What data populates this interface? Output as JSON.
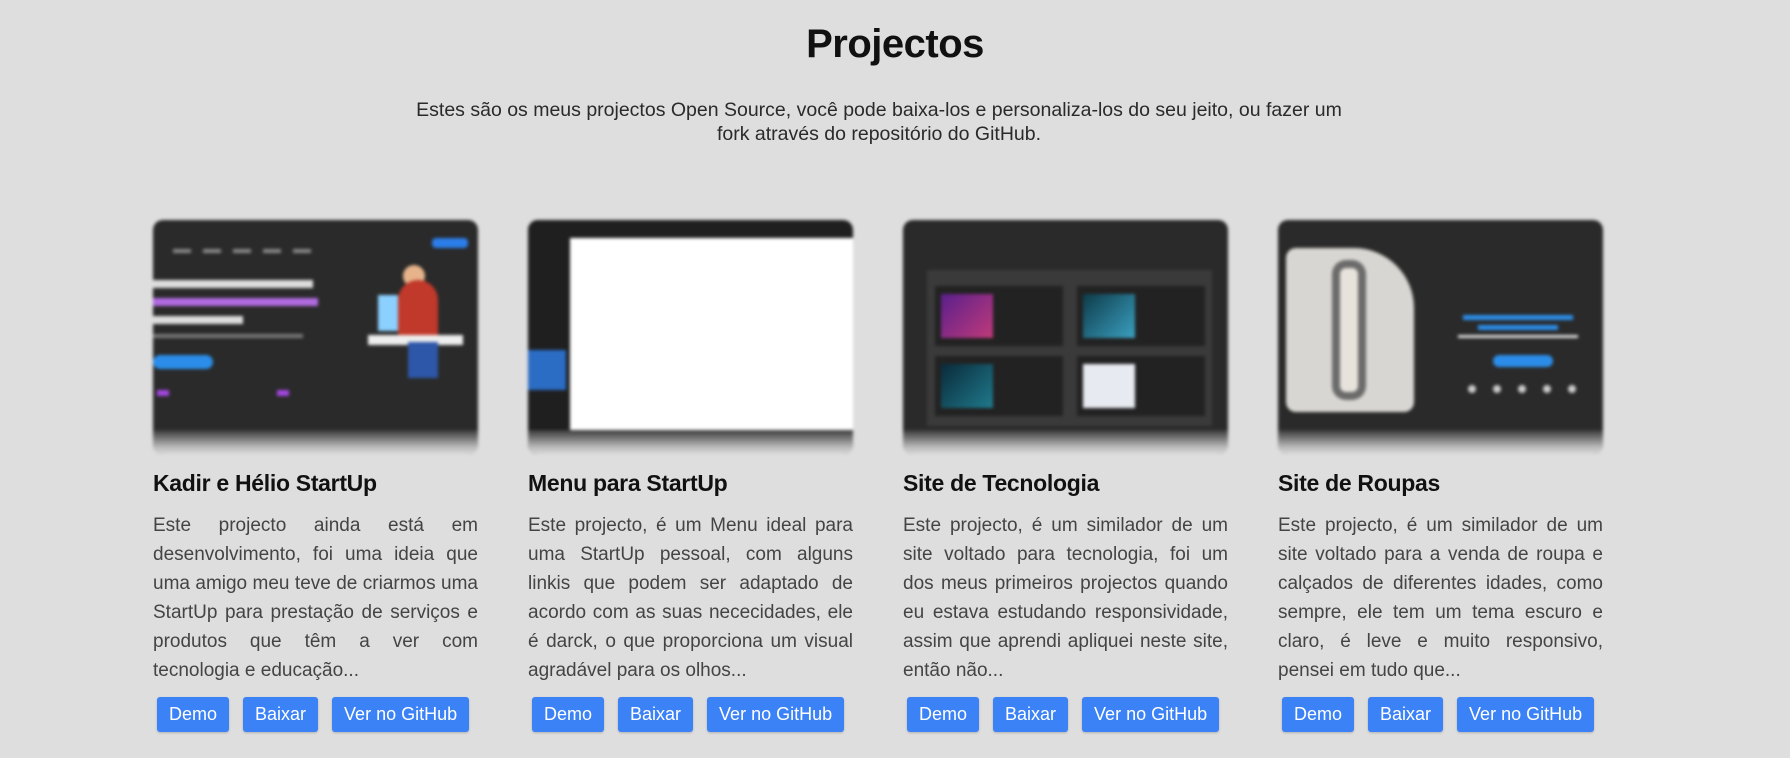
{
  "section": {
    "title": "Projectos",
    "subtitle": "Estes são os meus projectos Open Source, você pode baixa-los e personaliza-los do seu jeito, ou fazer um fork através do repositório do GitHub."
  },
  "projects": [
    {
      "title": "Kadir e Hélio StartUp",
      "description": "Este projecto ainda está em desenvolvimento, foi uma ideia que uma amigo meu teve de criarmos uma StartUp para prestação de serviços e produtos que têm a ver com tecnologia e educação...",
      "demo_label": "Demo",
      "download_label": "Baixar",
      "github_label": "Ver no GitHub"
    },
    {
      "title": "Menu para StartUp",
      "description": "Este projecto, é um Menu ideal para uma StartUp pessoal, com alguns linkis que podem ser adaptado de acordo com as suas nececidades, ele é darck, o que proporciona um visual agradável para os olhos...",
      "demo_label": "Demo",
      "download_label": "Baixar",
      "github_label": "Ver no GitHub"
    },
    {
      "title": "Site de Tecnologia",
      "description": "Este projecto, é um similador de um site voltado para tecnologia, foi um dos meus primeiros projectos quando eu estava estudando responsividade, assim que aprendi apliquei neste site, então não...",
      "demo_label": "Demo",
      "download_label": "Baixar",
      "github_label": "Ver no GitHub"
    },
    {
      "title": "Site de Roupas",
      "description": "Este projecto, é um similador de um site voltado para a venda de roupa e calçados de diferentes idades, como sempre, ele tem um tema escuro e claro, é leve e muito responsivo, pensei em tudo que...",
      "demo_label": "Demo",
      "download_label": "Baixar",
      "github_label": "Ver no GitHub"
    }
  ],
  "colors": {
    "background": "#dedede",
    "button": "#3b82f6",
    "button_text": "#ffffff"
  }
}
